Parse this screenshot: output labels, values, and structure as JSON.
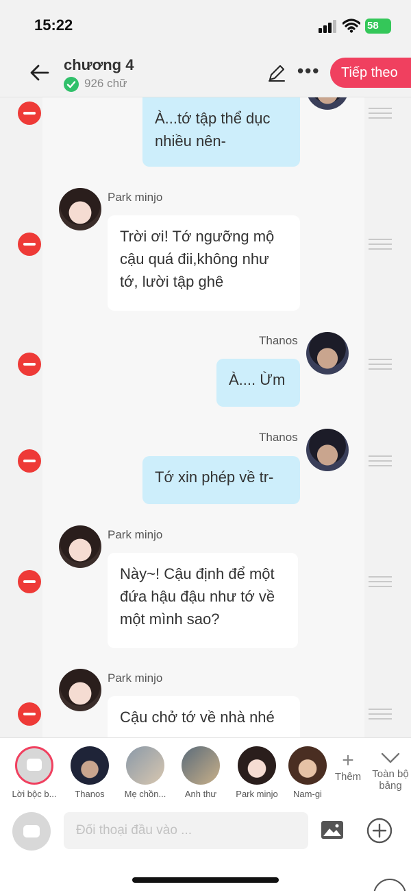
{
  "status_bar": {
    "time": "15:22",
    "battery": "58"
  },
  "header": {
    "title": "chương 4",
    "word_count": "926 chữ",
    "next_label": "Tiếp theo",
    "more": "•••"
  },
  "messages": [
    {
      "side": "right",
      "name": "",
      "text": "À...tớ tập thể dục nhiều nên-"
    },
    {
      "side": "left",
      "name": "Park minjo",
      "text": "Trời ơi! Tớ ngưỡng mộ cậu quá đii,không như tớ, lười tập ghê"
    },
    {
      "side": "right",
      "name": "Thanos",
      "text": "À.... Ừm"
    },
    {
      "side": "right",
      "name": "Thanos",
      "text": "Tớ xin phép về tr-"
    },
    {
      "side": "left",
      "name": "Park minjo",
      "text": "Này~! Cậu định để một đứa hậu đậu như tớ về một mình sao?"
    },
    {
      "side": "left",
      "name": "Park minjo",
      "text": "Cậu chở tớ về nhà nhé"
    }
  ],
  "characters": [
    {
      "label": "Lời bộc b..."
    },
    {
      "label": "Thanos"
    },
    {
      "label": "Mẹ chồn..."
    },
    {
      "label": "Anh thư"
    },
    {
      "label": "Park minjo"
    },
    {
      "label": "Nam-gi"
    }
  ],
  "toolbar": {
    "add_label": "Thêm",
    "all_label": "Toàn bộ bảng"
  },
  "composer": {
    "placeholder": "Đối thoại đầu vào ..."
  },
  "colors": {
    "accent": "#f0405f",
    "bubble_right": "#cdeefb",
    "delete": "#ee3a37"
  }
}
